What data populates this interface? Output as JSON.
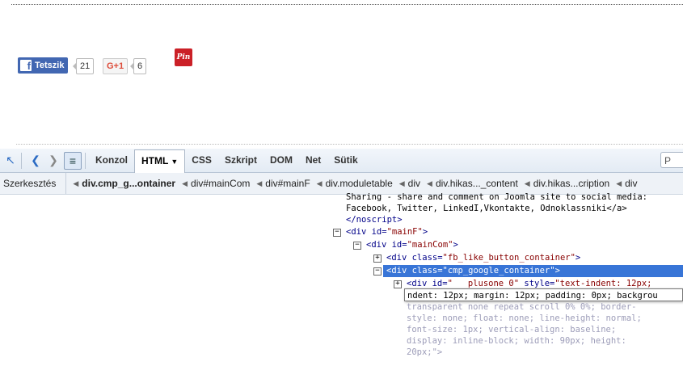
{
  "social": {
    "fb_label": "Tetszik",
    "fb_count": "21",
    "gplus_label": "G+1",
    "gplus_count": "6",
    "pinit_label": "Pin it"
  },
  "toolbar": {
    "tabs": [
      "Konzol",
      "HTML",
      "CSS",
      "Szkript",
      "DOM",
      "Net",
      "Sütik"
    ],
    "active_tab": "HTML",
    "search_glyph": "P"
  },
  "breadcrumb": {
    "edit_label": "Szerkesztés",
    "items": [
      "div.cmp_g...ontainer",
      "div#mainCom",
      "div#mainF",
      "div.moduletable",
      "div",
      "div.hikas..._content",
      "div.hikas...cription",
      "div"
    ]
  },
  "code": {
    "line1": "Sharing - share and comment on Joomla site to social media:",
    "line2": "Facebook, Twitter, LinkedI,Vkontakte, Odnoklassniki</a>",
    "line3": "</noscript>",
    "mainF_open": "<div ",
    "mainF_attr": "id=",
    "mainF_val": "\"mainF\"",
    "mainF_close": ">",
    "mainCom_open": "<div ",
    "mainCom_attr": "id=",
    "mainCom_val": "\"mainCom\"",
    "mainCom_close": ">",
    "fb_open": "<div ",
    "fb_attr": "class=",
    "fb_val": "\"fb_like_button_container\"",
    "fb_close": ">",
    "selected": "<div class=\"cmp_google_container\">",
    "plus_open": "<div ",
    "plus_attr1": "id=",
    "plus_val1": "\"   plusone 0\"",
    "plus_attr2": " style=",
    "plus_val2": "\"text-indent: 12px;",
    "tooltip": "ndent: 12px; margin: 12px; padding: 0px; backgrou",
    "style1": "transparent none repeat scroll 0% 0%; border-",
    "style2": "style: none; float: none; line-height: normal;",
    "style3": "font-size: 1px; vertical-align: baseline;",
    "style4": "display: inline-block; width: 90px; height:",
    "style5": "20px;\">"
  }
}
